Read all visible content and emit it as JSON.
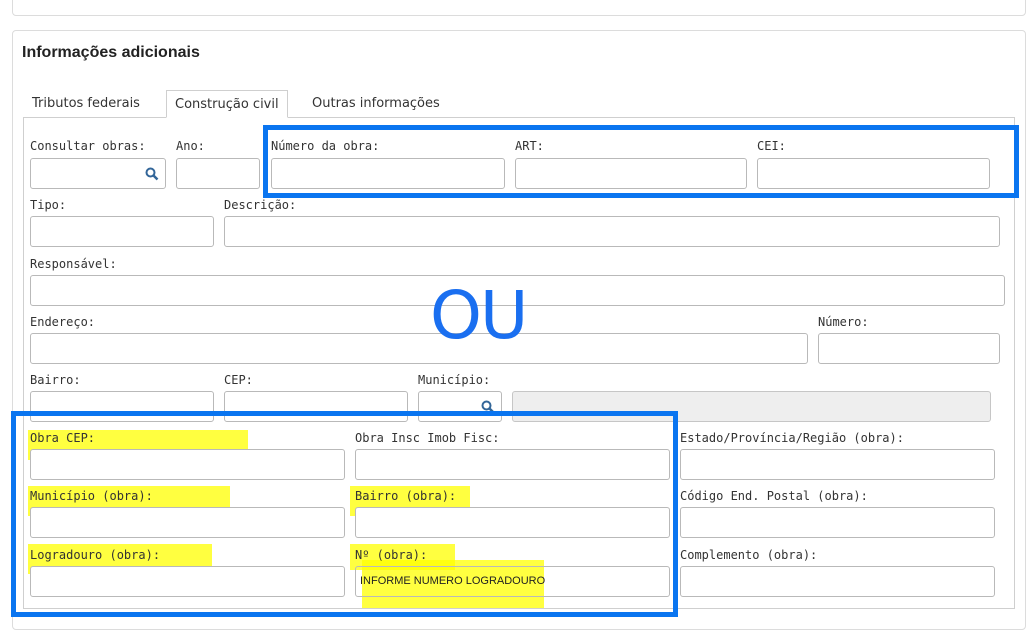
{
  "section": {
    "title": "Informações adicionais"
  },
  "tabs": [
    {
      "label": "Tributos federais"
    },
    {
      "label": "Construção civil"
    },
    {
      "label": "Outras informações"
    }
  ],
  "annotation": {
    "text": "OU",
    "color": "#1a6ff0",
    "box_color": "#0a75f0",
    "highlight_color": "#ffff00"
  },
  "fields": {
    "consultar_obras": {
      "label": "Consultar obras:",
      "value": ""
    },
    "ano": {
      "label": "Ano:",
      "value": ""
    },
    "numero_obra": {
      "label": "Número da obra:",
      "value": ""
    },
    "art": {
      "label": "ART:",
      "value": ""
    },
    "cei": {
      "label": "CEI:",
      "value": ""
    },
    "tipo": {
      "label": "Tipo:",
      "value": ""
    },
    "descricao": {
      "label": "Descrição:",
      "value": ""
    },
    "responsavel": {
      "label": "Responsável:",
      "value": ""
    },
    "endereco": {
      "label": "Endereço:",
      "value": ""
    },
    "numero": {
      "label": "Número:",
      "value": ""
    },
    "bairro": {
      "label": "Bairro:",
      "value": ""
    },
    "cep": {
      "label": "CEP:",
      "value": ""
    },
    "municipio": {
      "label": "Município:",
      "value": ""
    },
    "obra_cep": {
      "label": "Obra CEP:",
      "value": ""
    },
    "obra_insc": {
      "label": "Obra Insc Imob Fisc:",
      "value": ""
    },
    "estado_obra": {
      "label": "Estado/Província/Região (obra):",
      "value": ""
    },
    "municipio_obra": {
      "label": "Município (obra):",
      "value": ""
    },
    "bairro_obra": {
      "label": "Bairro (obra):",
      "value": ""
    },
    "codigo_postal_obra": {
      "label": "Código End. Postal (obra):",
      "value": ""
    },
    "logradouro_obra": {
      "label": "Logradouro (obra):",
      "value": ""
    },
    "numero_obra_end": {
      "label": "Nº (obra):",
      "value": "INFORME NUMERO LOGRADOURO"
    },
    "complemento_obra": {
      "label": "Complemento (obra):",
      "value": ""
    }
  }
}
